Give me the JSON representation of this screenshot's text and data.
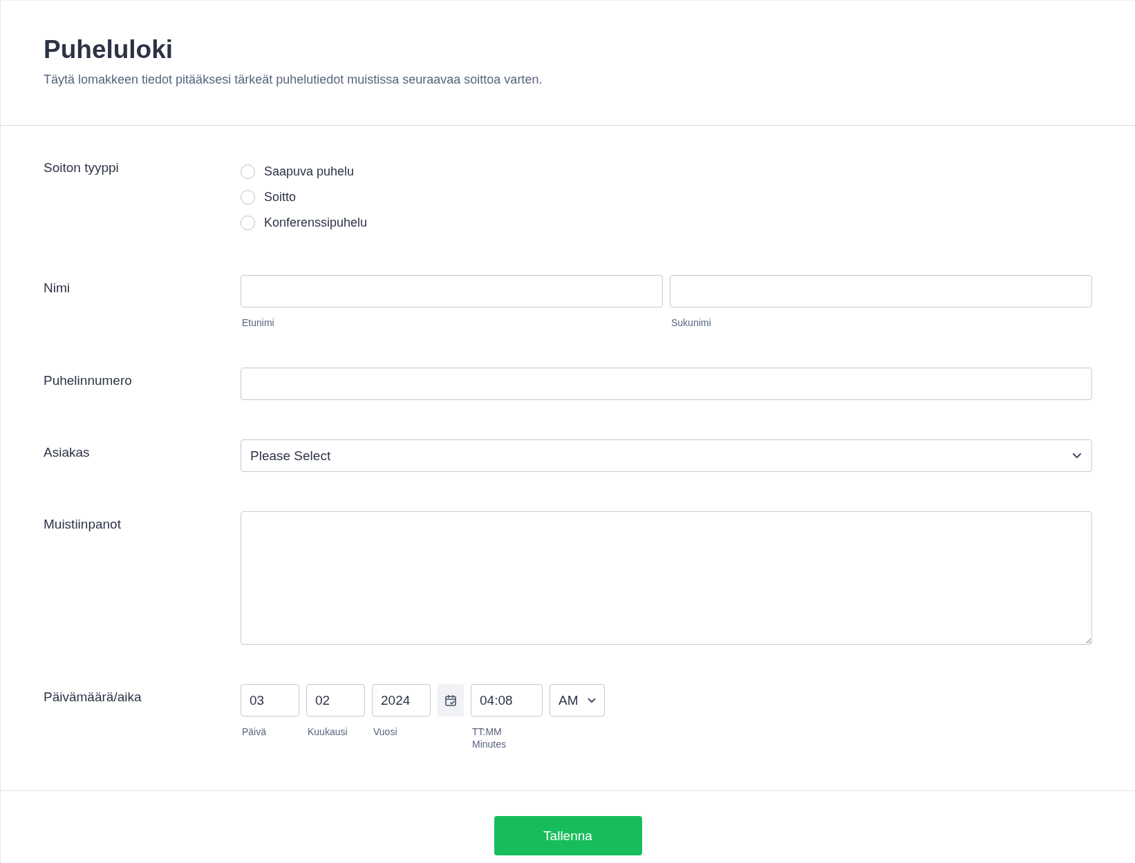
{
  "header": {
    "title": "Puheluloki",
    "description": "Täytä lomakkeen tiedot pitääksesi tärkeät puhelutiedot muistissa seuraavaa soittoa varten."
  },
  "fields": [
    {
      "kind": "radio",
      "label": "Soiton tyyppi",
      "options": [
        {
          "label": "Saapuva puhelu",
          "selected": false
        },
        {
          "label": "Soitto",
          "selected": false
        },
        {
          "label": "Konferenssipuhelu",
          "selected": false
        }
      ]
    },
    {
      "kind": "name",
      "label": "Nimi",
      "parts": [
        {
          "sublabel": "Etunimi"
        },
        {
          "sublabel": "Sukunimi"
        }
      ]
    },
    {
      "kind": "text",
      "label": "Puhelinnumero"
    },
    {
      "kind": "select",
      "label": "Asiakas",
      "value": "Please Select"
    },
    {
      "kind": "textarea",
      "label": "Muistiinpanot"
    },
    {
      "kind": "datetime",
      "label": "Päivämäärä/aika",
      "date": [
        {
          "value": "03",
          "sublabel": "Päivä"
        },
        {
          "value": "02",
          "sublabel": "Kuukausi"
        },
        {
          "value": "2024",
          "sublabel": "Vuosi"
        }
      ],
      "time": {
        "value": "04:08",
        "sublabels": [
          "TT:MM",
          "Minutes"
        ]
      },
      "ampm": "AM"
    }
  ],
  "submit": "Tallenna"
}
